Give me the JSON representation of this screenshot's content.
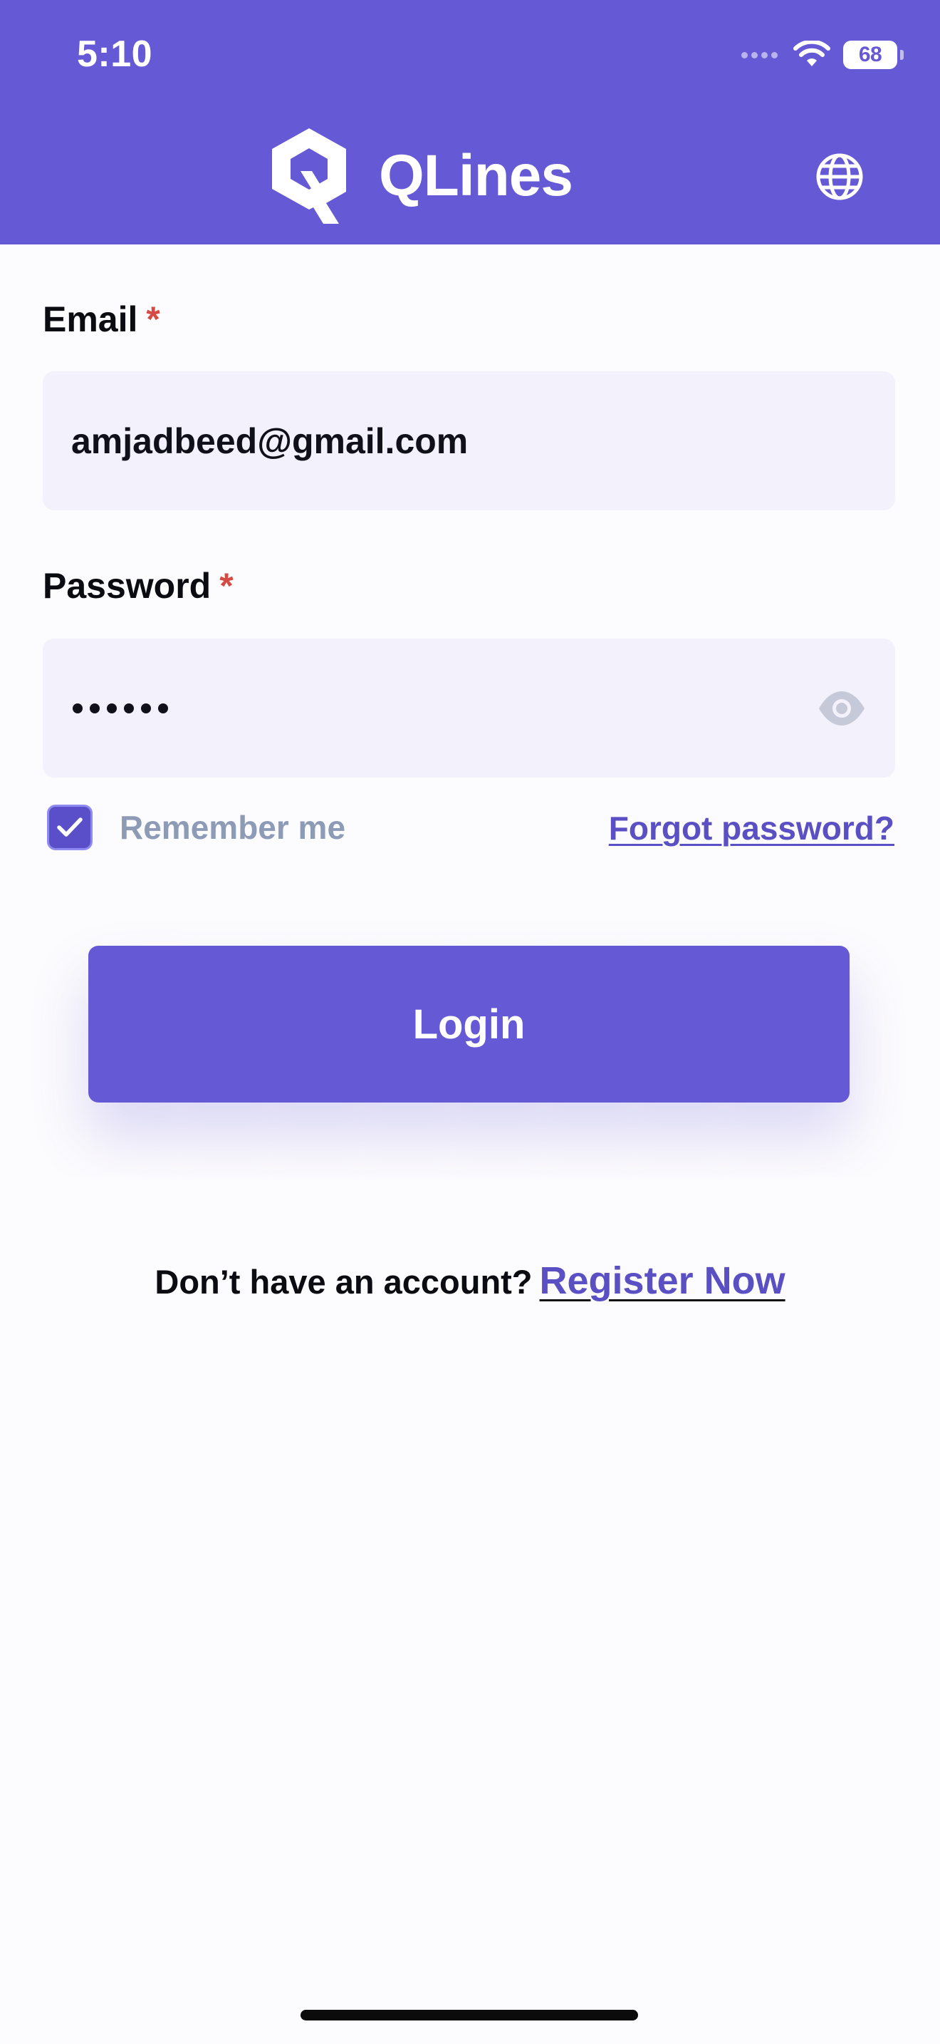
{
  "status_bar": {
    "time": "5:10",
    "battery_level": "68",
    "icons": [
      "signal-dots-icon",
      "wifi-icon",
      "battery-icon"
    ]
  },
  "header": {
    "brand_name": "QLines",
    "logo_icon": "qlines-logo-icon",
    "language_icon": "globe-icon",
    "background_color": "#6659d5"
  },
  "form": {
    "email": {
      "label": "Email",
      "required_mark": "*",
      "value": "amjadbeed@gmail.com"
    },
    "password": {
      "label": "Password",
      "required_mark": "*",
      "masked_length": 6,
      "toggle_icon": "eye-icon"
    },
    "remember_me": {
      "label": "Remember me",
      "checked": true
    },
    "forgot_password_label": "Forgot password?",
    "login_label": "Login"
  },
  "footer": {
    "prompt": "Don’t have an account?",
    "register_label": "Register Now"
  },
  "colors": {
    "primary": "#6659d5",
    "link": "#5a4fc3",
    "required": "#d64a45",
    "muted_text": "#8d9bb6",
    "input_bg": "#f3f1fb",
    "page_bg": "#fcfbfd"
  }
}
